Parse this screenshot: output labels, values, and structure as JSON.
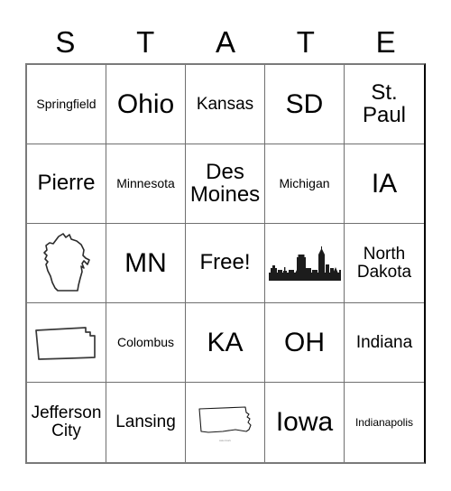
{
  "card": {
    "header_letters": [
      "S",
      "T",
      "A",
      "T",
      "E"
    ],
    "free_space_label": "Free!",
    "columns": 5,
    "rows": 5,
    "colors": {
      "text": "#000000",
      "grid_line": "#6f6f6f",
      "border": "#000000",
      "background": "#ffffff",
      "watermark": "#8c8c8c"
    },
    "cells": [
      {
        "row": 1,
        "col": 1,
        "type": "text",
        "label": "Springfield",
        "size": "fs-sm"
      },
      {
        "row": 1,
        "col": 2,
        "type": "text",
        "label": "Ohio",
        "size": "fs-xl"
      },
      {
        "row": 1,
        "col": 3,
        "type": "text",
        "label": "Kansas",
        "size": "fs-md"
      },
      {
        "row": 1,
        "col": 4,
        "type": "text",
        "label": "SD",
        "size": "fs-xl"
      },
      {
        "row": 1,
        "col": 5,
        "type": "text",
        "label": "St. Paul",
        "size": "fs-lg"
      },
      {
        "row": 2,
        "col": 1,
        "type": "text",
        "label": "Pierre",
        "size": "fs-lg"
      },
      {
        "row": 2,
        "col": 2,
        "type": "text",
        "label": "Minnesota",
        "size": "fs-sm"
      },
      {
        "row": 2,
        "col": 3,
        "type": "text",
        "label": "Des Moines",
        "size": "fs-lg"
      },
      {
        "row": 2,
        "col": 4,
        "type": "text",
        "label": "Michigan",
        "size": "fs-sm"
      },
      {
        "row": 2,
        "col": 5,
        "type": "text",
        "label": "IA",
        "size": "fs-xl"
      },
      {
        "row": 3,
        "col": 1,
        "type": "shape",
        "shape": "wisconsin-outline",
        "label": ""
      },
      {
        "row": 3,
        "col": 2,
        "type": "text",
        "label": "MN",
        "size": "fs-xl"
      },
      {
        "row": 3,
        "col": 3,
        "type": "text",
        "label": "Free!",
        "size": "fs-lg",
        "free": true
      },
      {
        "row": 3,
        "col": 4,
        "type": "shape",
        "shape": "city-skyline",
        "label": ""
      },
      {
        "row": 3,
        "col": 5,
        "type": "text",
        "label": "North Dakota",
        "size": "fs-md"
      },
      {
        "row": 4,
        "col": 1,
        "type": "shape",
        "shape": "kansas-outline",
        "label": ""
      },
      {
        "row": 4,
        "col": 2,
        "type": "text",
        "label": "Colombus",
        "size": "fs-sm"
      },
      {
        "row": 4,
        "col": 3,
        "type": "text",
        "label": "KA",
        "size": "fs-xl"
      },
      {
        "row": 4,
        "col": 4,
        "type": "text",
        "label": "OH",
        "size": "fs-xl"
      },
      {
        "row": 4,
        "col": 5,
        "type": "text",
        "label": "Indiana",
        "size": "fs-md"
      },
      {
        "row": 5,
        "col": 1,
        "type": "text",
        "label": "Jefferson City",
        "size": "fs-md"
      },
      {
        "row": 5,
        "col": 2,
        "type": "text",
        "label": "Lansing",
        "size": "fs-md"
      },
      {
        "row": 5,
        "col": 3,
        "type": "shape",
        "shape": "south-dakota-outline",
        "label": "",
        "watermark": "watermark"
      },
      {
        "row": 5,
        "col": 4,
        "type": "text",
        "label": "Iowa",
        "size": "fs-xl"
      },
      {
        "row": 5,
        "col": 5,
        "type": "text",
        "label": "Indianapolis",
        "size": "fs-xs"
      }
    ]
  }
}
